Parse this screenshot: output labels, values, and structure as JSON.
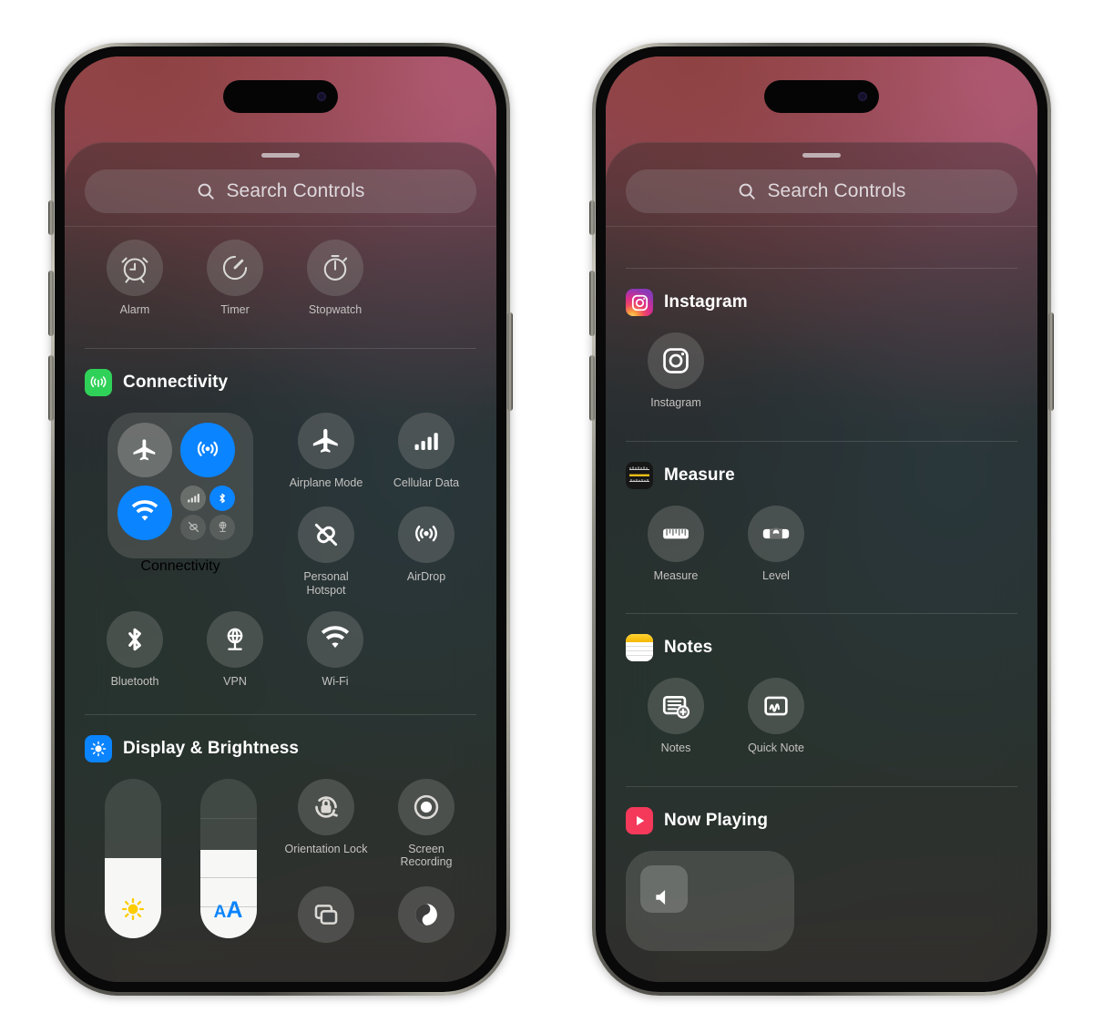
{
  "search": {
    "placeholder": "Search Controls",
    "icon": "search-icon"
  },
  "left_phone": {
    "clock_controls": [
      {
        "label": "Alarm",
        "icon": "alarm-clock-icon"
      },
      {
        "label": "Timer",
        "icon": "timer-icon"
      },
      {
        "label": "Stopwatch",
        "icon": "stopwatch-icon"
      }
    ],
    "groups": [
      {
        "title": "Connectivity",
        "icon": "connectivity-app-icon",
        "icon_color": "#30d158",
        "controls": [
          {
            "label": "Connectivity",
            "icon": "connectivity-module-icon",
            "type": "module"
          },
          {
            "label": "Airplane Mode",
            "icon": "airplane-icon",
            "state": "off"
          },
          {
            "label": "Cellular Data",
            "icon": "cellular-bars-icon",
            "state": "off"
          },
          {
            "label": "Personal Hotspot",
            "icon": "hotspot-off-icon",
            "state": "off"
          },
          {
            "label": "AirDrop",
            "icon": "airdrop-icon",
            "state": "off"
          },
          {
            "label": "Bluetooth",
            "icon": "bluetooth-icon",
            "state": "off"
          },
          {
            "label": "VPN",
            "icon": "vpn-globe-icon",
            "state": "off"
          },
          {
            "label": "Wi-Fi",
            "icon": "wifi-icon",
            "state": "off"
          }
        ],
        "module_toggles": [
          {
            "name": "airplane-mode",
            "icon": "airplane-icon",
            "state": "off"
          },
          {
            "name": "cellular",
            "icon": "airdrop-icon",
            "state": "on"
          },
          {
            "name": "wifi",
            "icon": "wifi-icon",
            "state": "on"
          },
          {
            "name": "cellular-data",
            "icon": "cellular-bars-icon",
            "state": "off"
          },
          {
            "name": "bluetooth",
            "icon": "bluetooth-icon",
            "state": "on"
          },
          {
            "name": "personal-hotspot",
            "icon": "hotspot-off-icon",
            "state": "off"
          },
          {
            "name": "vpn",
            "icon": "vpn-globe-icon",
            "state": "off"
          }
        ]
      },
      {
        "title": "Display & Brightness",
        "icon": "brightness-app-icon",
        "icon_color": "#0a84ff",
        "controls": [
          {
            "label": "",
            "icon": "brightness-slider",
            "type": "slider",
            "value": 50
          },
          {
            "label": "",
            "icon": "text-size-slider",
            "type": "slider",
            "value": 45
          },
          {
            "label": "Orientation Lock",
            "icon": "orientation-lock-icon",
            "state": "off"
          },
          {
            "label": "Screen Recording",
            "icon": "screen-record-icon",
            "state": "off"
          },
          {
            "label": "",
            "icon": "screen-mirroring-icon",
            "state": "off"
          },
          {
            "label": "",
            "icon": "dark-mode-icon",
            "state": "off"
          }
        ]
      }
    ]
  },
  "right_phone": {
    "groups": [
      {
        "title": "Instagram",
        "icon": "instagram-app-icon",
        "controls": [
          {
            "label": "Instagram",
            "icon": "instagram-glyph-icon"
          }
        ]
      },
      {
        "title": "Measure",
        "icon": "measure-app-icon",
        "controls": [
          {
            "label": "Measure",
            "icon": "ruler-icon"
          },
          {
            "label": "Level",
            "icon": "level-icon"
          }
        ]
      },
      {
        "title": "Notes",
        "icon": "notes-app-icon",
        "controls": [
          {
            "label": "Notes",
            "icon": "new-note-icon"
          },
          {
            "label": "Quick Note",
            "icon": "quick-note-icon"
          }
        ]
      },
      {
        "title": "Now Playing",
        "icon": "now-playing-app-icon",
        "controls": []
      }
    ]
  },
  "colors": {
    "accent_blue": "#0a84ff",
    "green": "#30d158",
    "yellow": "#ffcc00",
    "red": "#f4395b",
    "puck": "rgba(150,152,148,.30)"
  }
}
